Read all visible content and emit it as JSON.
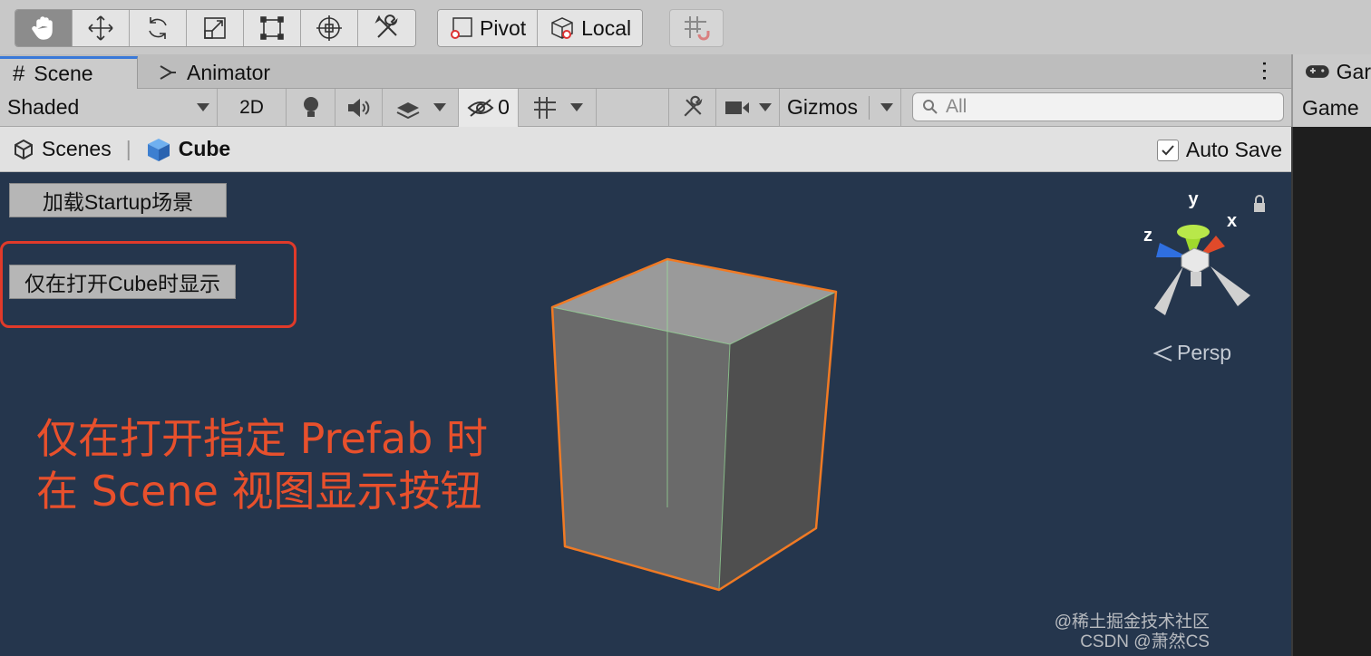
{
  "toolbar": {
    "tools": [
      {
        "icon": "hand-icon",
        "active": true
      },
      {
        "icon": "move-icon",
        "active": false
      },
      {
        "icon": "rotate-icon",
        "active": false
      },
      {
        "icon": "scale-icon",
        "active": false
      },
      {
        "icon": "rect-icon",
        "active": false
      },
      {
        "icon": "transform-icon",
        "active": false
      },
      {
        "icon": "custom-tools-icon",
        "active": false
      }
    ],
    "pivot_label": "Pivot",
    "local_label": "Local"
  },
  "tabs": {
    "scene": "Scene",
    "animator": "Animator",
    "game": "Game",
    "game_short": "Gar"
  },
  "scene_toolbar": {
    "shading_mode": "Shaded",
    "mode_2d": "2D",
    "hidden_count": "0",
    "gizmos": "Gizmos",
    "search_placeholder": "All"
  },
  "breadcrumb": {
    "scenes": "Scenes",
    "current": "Cube",
    "auto_save": "Auto Save",
    "auto_save_checked": true
  },
  "viewport": {
    "load_button": "加载Startup场景",
    "cube_only_button": "仅在打开Cube时显示",
    "annotation_line1": "仅在打开指定 Prefab 时",
    "annotation_line2": "在 Scene 视图显示按钮",
    "persp_label": "Persp",
    "gizmo_axes": {
      "y": "y",
      "x": "x",
      "z": "z"
    },
    "watermark_line1": "@稀土掘金技术社区",
    "watermark_line2": "CSDN @萧然CS",
    "colors": {
      "background": "#25364d",
      "annotation": "#e8502c",
      "selection_outline": "#f07a24"
    }
  }
}
